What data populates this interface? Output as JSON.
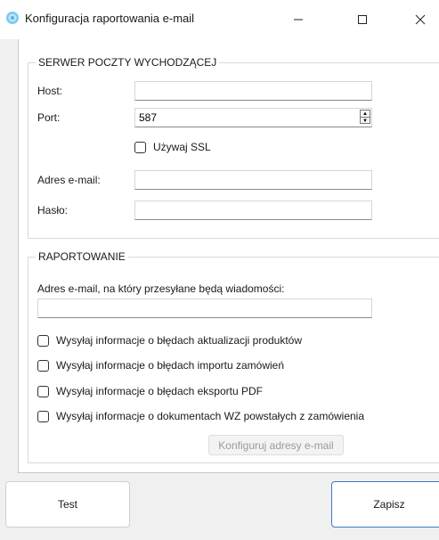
{
  "window": {
    "title": "Konfiguracja raportowania e-mail",
    "icon": "gear-app-icon",
    "controls": [
      "minimize-icon",
      "maximize-icon",
      "close-icon"
    ]
  },
  "server": {
    "legend": "SERWER POCZTY WYCHODZĄCEJ",
    "host_label": "Host:",
    "host_value": "",
    "port_label": "Port:",
    "port_value": "587",
    "ssl_label": "Używaj SSL",
    "ssl_checked": false,
    "email_label": "Adres e-mail:",
    "email_value": "",
    "password_label": "Hasło:",
    "password_value": ""
  },
  "reporting": {
    "legend": "RAPORTOWANIE",
    "recipient_label": "Adres e-mail, na który przesyłane będą wiadomości:",
    "recipient_value": "",
    "options": [
      {
        "label": "Wysyłaj informacje o błędach aktualizacji produktów",
        "checked": false
      },
      {
        "label": "Wysyłaj informacje o błędach importu zamówień",
        "checked": false
      },
      {
        "label": "Wysyłaj informacje o błędach eksportu PDF",
        "checked": false
      },
      {
        "label": "Wysyłaj informacje o dokumentach WZ powstałych z zamówienia",
        "checked": false
      }
    ],
    "configure_button": "Konfiguruj adresy e-mail"
  },
  "footer": {
    "test_button": "Test",
    "save_button": "Zapisz"
  },
  "colors": {
    "accent": "#3d78c7",
    "disabled_text": "#9a9a9a"
  }
}
